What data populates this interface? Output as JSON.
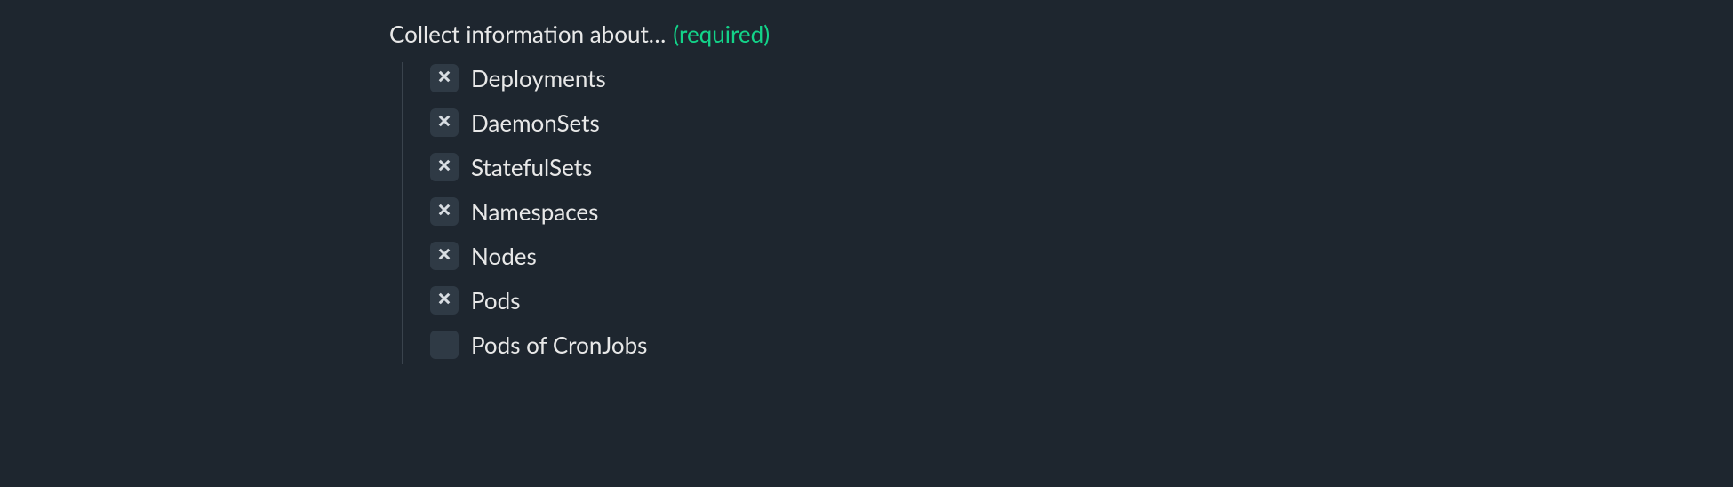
{
  "section": {
    "title": "Collect information about…",
    "required_label": "(required)"
  },
  "options": [
    {
      "label": "Deployments",
      "checked": true
    },
    {
      "label": "DaemonSets",
      "checked": true
    },
    {
      "label": "StatefulSets",
      "checked": true
    },
    {
      "label": "Namespaces",
      "checked": true
    },
    {
      "label": "Nodes",
      "checked": true
    },
    {
      "label": "Pods",
      "checked": true
    },
    {
      "label": "Pods of CronJobs",
      "checked": false
    }
  ]
}
